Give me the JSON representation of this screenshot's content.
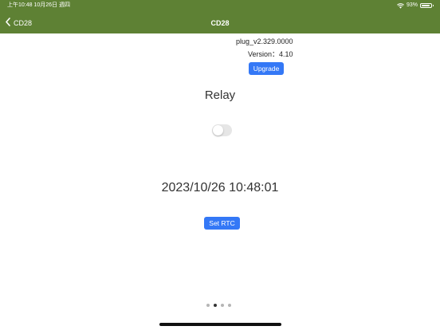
{
  "status_bar": {
    "time_date": "上午10:48   10月26日 週四",
    "battery_text": "93%",
    "battery_level": 0.93
  },
  "nav": {
    "back_label": "CD28",
    "title": "CD28"
  },
  "device": {
    "firmware": "plug_v2.329.0000",
    "version": "Version：4.10",
    "upgrade_label": "Upgrade"
  },
  "relay": {
    "label": "Relay",
    "on": false
  },
  "rtc": {
    "datetime": "2023/10/26 10:48:01",
    "set_label": "Set RTC"
  },
  "pager": {
    "count": 4,
    "active_index": 1
  },
  "colors": {
    "nav_bar": "#5e8134",
    "button": "#3478f6",
    "toggle_off": "#e6e6e6",
    "text": "#333333"
  }
}
